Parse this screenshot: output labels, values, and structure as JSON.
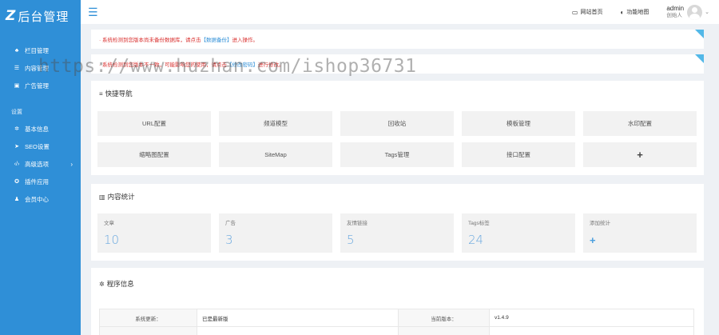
{
  "brand": {
    "mark": "Z",
    "title": "后台管理"
  },
  "sidebar": {
    "items": [
      {
        "icon": "sitemap-icon",
        "glyph": "♣",
        "label": "栏目管理"
      },
      {
        "icon": "list-icon",
        "glyph": "☰",
        "label": "内容管理"
      },
      {
        "icon": "image-icon",
        "glyph": "▣",
        "label": "广告管理"
      }
    ],
    "section_label": "设置",
    "settings": [
      {
        "icon": "gear-icon",
        "glyph": "✲",
        "label": "基本信息"
      },
      {
        "icon": "send-icon",
        "glyph": "➤",
        "label": "SEO设置"
      },
      {
        "icon": "code-icon",
        "glyph": "‹/›",
        "label": "高级选项",
        "has_arrow": true,
        "arrow": "›"
      },
      {
        "icon": "puzzle-icon",
        "glyph": "✪",
        "label": "插件应用"
      },
      {
        "icon": "user-icon",
        "glyph": "♟",
        "label": "会员中心"
      }
    ]
  },
  "header": {
    "menu_glyph": "☰",
    "site_home": {
      "glyph": "▭",
      "label": "网站首页"
    },
    "feature_map": {
      "glyph": "◐",
      "label": "功能地图"
    },
    "user": {
      "name": "admin",
      "role": "创始人",
      "caret": "⌄"
    }
  },
  "notices": {
    "n1": {
      "prefix": "· 系统检测到您版本尚未备份数据库，请点击 ",
      "link": "【数据备份】",
      "suffix": " 进入操作。"
    },
    "n2": {
      "prefix": "· 系统检测到您版本不一致，可能影响您的使用，请点击",
      "link": "【修改密码】",
      "suffix": "进行修改。"
    }
  },
  "watermark": "https://www.huzhan.com/ishop36731",
  "quick_nav": {
    "glyph": "≡",
    "title": "快捷导航",
    "items": [
      "URL配置",
      "频道模型",
      "回收站",
      "模板管理",
      "水印配置",
      "缩略图配置",
      "SiteMap",
      "Tags管理",
      "接口配置",
      "+"
    ]
  },
  "stats": {
    "glyph": "▥",
    "title": "内容统计",
    "items": [
      {
        "label": "文章",
        "value": "10"
      },
      {
        "label": "广告",
        "value": "3"
      },
      {
        "label": "友情链接",
        "value": "5"
      },
      {
        "label": "Tags标签",
        "value": "24"
      },
      {
        "label": "添加统计",
        "value": "+"
      }
    ]
  },
  "program_info": {
    "glyph": "✲",
    "title": "程序信息",
    "rows": [
      {
        "k1": "系统更新：",
        "v1": "已是最新版",
        "k2": "当前版本：",
        "v2": "v1.4.9"
      },
      {
        "k1": "",
        "v1": "",
        "k2": "",
        "v2": ""
      }
    ]
  },
  "colors": {
    "sidebar": "#2f8fd7",
    "accent": "#6aa8df",
    "notice_text": "#d9302f",
    "corner": "#52b8e8"
  }
}
